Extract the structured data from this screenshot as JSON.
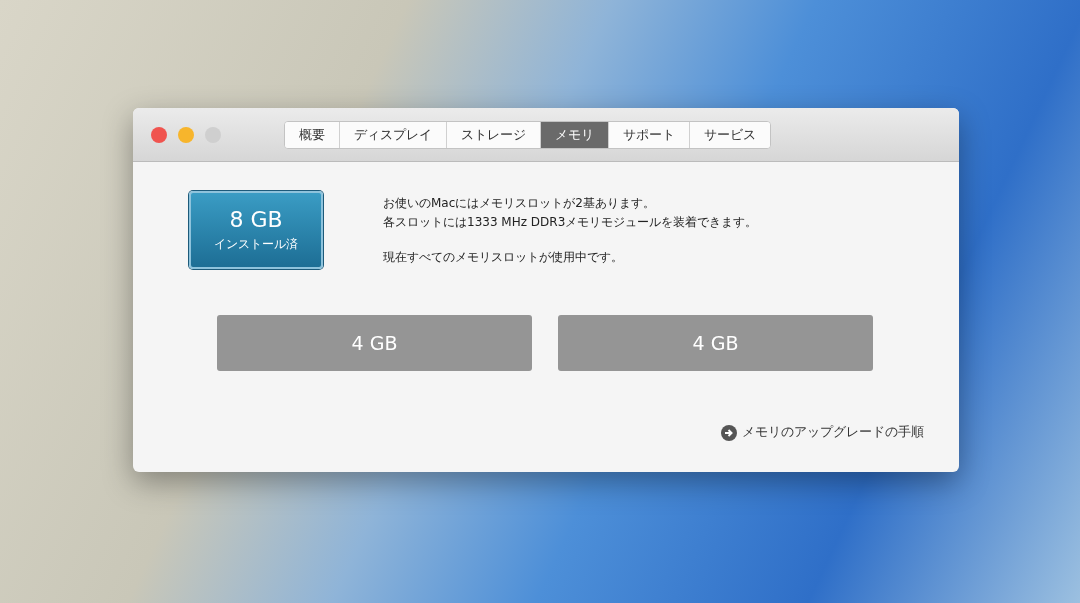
{
  "tabs": [
    {
      "label": "概要",
      "selected": false
    },
    {
      "label": "ディスプレイ",
      "selected": false
    },
    {
      "label": "ストレージ",
      "selected": false
    },
    {
      "label": "メモリ",
      "selected": true
    },
    {
      "label": "サポート",
      "selected": false
    },
    {
      "label": "サービス",
      "selected": false
    }
  ],
  "installed": {
    "amount": "8 GB",
    "label": "インストール済"
  },
  "info": [
    "お使いのMacにはメモリスロットが2基あります。",
    "各スロットには1333 MHz DDR3メモリモジュールを装着できます。",
    "現在すべてのメモリスロットが使用中です。"
  ],
  "slots": [
    "4 GB",
    "4 GB"
  ],
  "upgrade_link": "メモリのアップグレードの手順"
}
